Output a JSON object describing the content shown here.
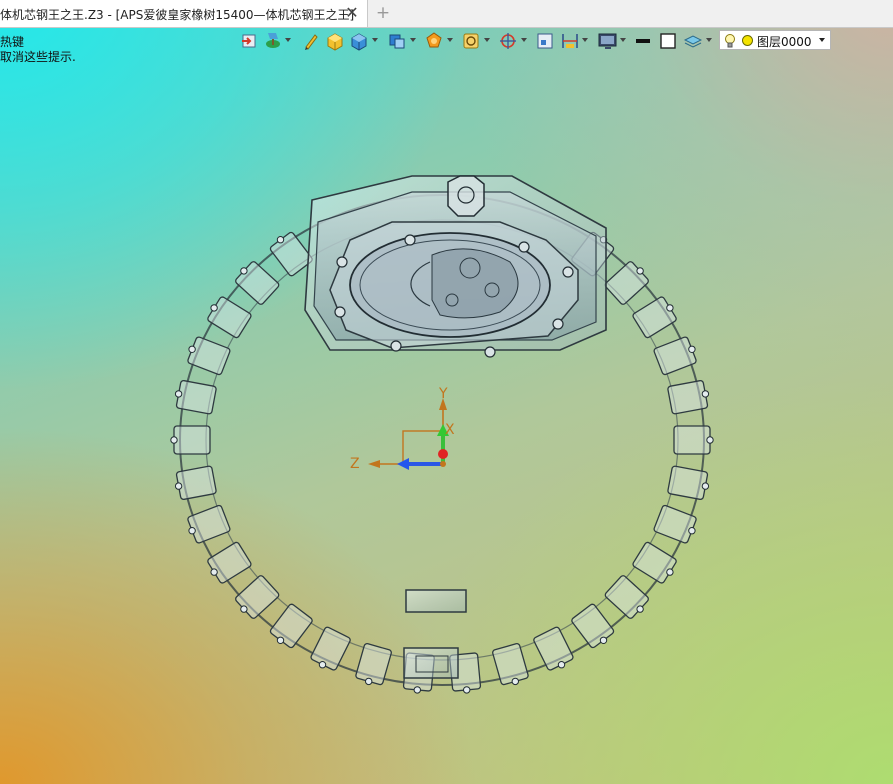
{
  "tab": {
    "title": "体机芯钢王之王.Z3 - [APS爱彼皇家橡树15400—体机芯钢王之王]",
    "close_glyph": "✕",
    "add_glyph": "+"
  },
  "hints": {
    "line1": "热键",
    "line2": "取消这些提示."
  },
  "toolbar": {
    "icons": [
      "import-icon",
      "paint-dropdown-icon",
      "pen-icon",
      "solid-box-icon",
      "cube-view-dropdown-icon",
      "cube-shade-dropdown-icon",
      "render-mode-dropdown-icon",
      "wireframe-dropdown-icon",
      "pivot-dropdown-icon",
      "fit-view-icon",
      "dimension-dropdown-icon",
      "screen-dropdown-icon",
      "line-color-icon",
      "fill-color-icon",
      "layer-manage-dropdown-icon"
    ],
    "layer": {
      "name": "图层0000",
      "color": "#f4e300"
    }
  },
  "triad": {
    "x_label": "X",
    "y_label": "Y",
    "z_label": "Z"
  }
}
